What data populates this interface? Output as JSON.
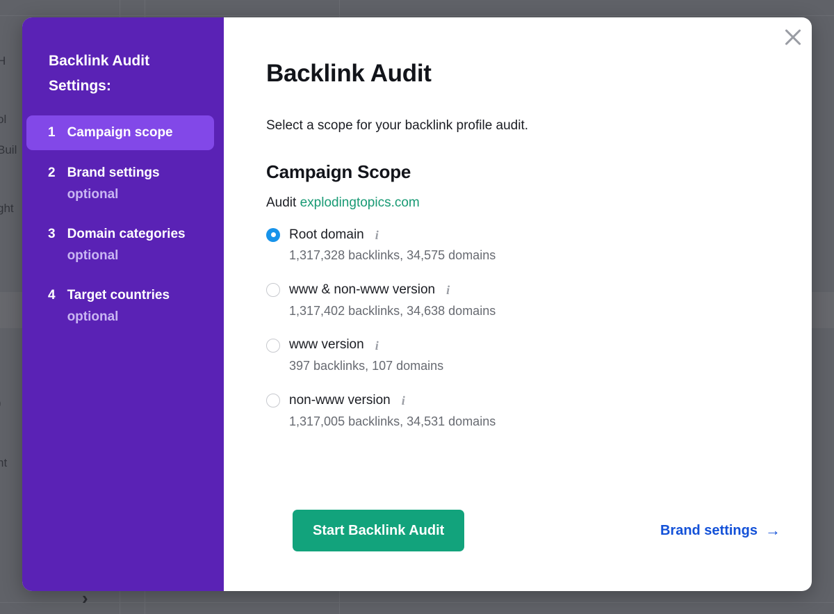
{
  "background": {
    "fragments": [
      "ol",
      "Buil",
      "ght",
      ")",
      "nt",
      "H"
    ],
    "chevron": "›"
  },
  "modal": {
    "close_icon": "close-icon",
    "sidebar": {
      "title": "Backlink Audit Settings:",
      "steps": [
        {
          "num": "1",
          "label": "Campaign scope",
          "optional": "",
          "active": true
        },
        {
          "num": "2",
          "label": "Brand settings",
          "optional": "optional",
          "active": false
        },
        {
          "num": "3",
          "label": "Domain categories",
          "optional": "optional",
          "active": false
        },
        {
          "num": "4",
          "label": "Target countries",
          "optional": "optional",
          "active": false
        }
      ]
    },
    "content": {
      "title": "Backlink Audit",
      "subtitle": "Select a scope for your backlink profile audit.",
      "section_title": "Campaign Scope",
      "audit_prefix": "Audit",
      "audit_domain": "explodingtopics.com",
      "info_glyph": "i",
      "options": [
        {
          "label": "Root domain",
          "stats": "1,317,328 backlinks, 34,575 domains",
          "selected": true
        },
        {
          "label": "www & non-www version",
          "stats": "1,317,402 backlinks, 34,638 domains",
          "selected": false
        },
        {
          "label": "www version",
          "stats": "397 backlinks, 107 domains",
          "selected": false
        },
        {
          "label": "non-www version",
          "stats": "1,317,005 backlinks, 34,531 domains",
          "selected": false
        }
      ]
    },
    "footer": {
      "primary_label": "Start Backlink Audit",
      "secondary_label": "Brand settings",
      "secondary_arrow": "→"
    }
  },
  "colors": {
    "sidebar_purple": "#5a22b5",
    "active_step_purple": "#8248e8",
    "link_green": "#189a74",
    "button_green": "#12a37c",
    "link_blue": "#1351d8",
    "radio_blue": "#1793ea",
    "overlay": "#606268"
  }
}
